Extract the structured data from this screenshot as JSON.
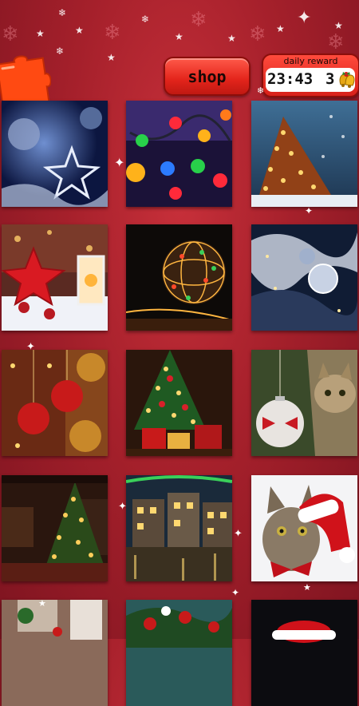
{
  "header": {
    "shop_label": "shop",
    "daily_reward": {
      "title": "daily reward",
      "timer": "23:43",
      "count": "3"
    }
  },
  "icons": {
    "logo": "puzzle-piece-icon",
    "reward": "christmas-bells-icon"
  },
  "colors": {
    "background": "#a5202b",
    "button": "#e3241b",
    "button_border": "#8c0e0a"
  },
  "puzzles": [
    {
      "name": "puzzle-blue-star-ornament"
    },
    {
      "name": "puzzle-colored-lights"
    },
    {
      "name": "puzzle-lit-tree-blue-sky"
    },
    {
      "name": "puzzle-red-star-lantern"
    },
    {
      "name": "puzzle-light-ball"
    },
    {
      "name": "puzzle-snowy-branch-ornament"
    },
    {
      "name": "puzzle-red-gold-baubles"
    },
    {
      "name": "puzzle-tree-with-gifts"
    },
    {
      "name": "puzzle-kitten-ornament"
    },
    {
      "name": "puzzle-tree-in-room"
    },
    {
      "name": "puzzle-christmas-town"
    },
    {
      "name": "puzzle-cat-santa-hat"
    },
    {
      "name": "puzzle-partial-1"
    },
    {
      "name": "puzzle-partial-2"
    },
    {
      "name": "puzzle-partial-3"
    }
  ]
}
